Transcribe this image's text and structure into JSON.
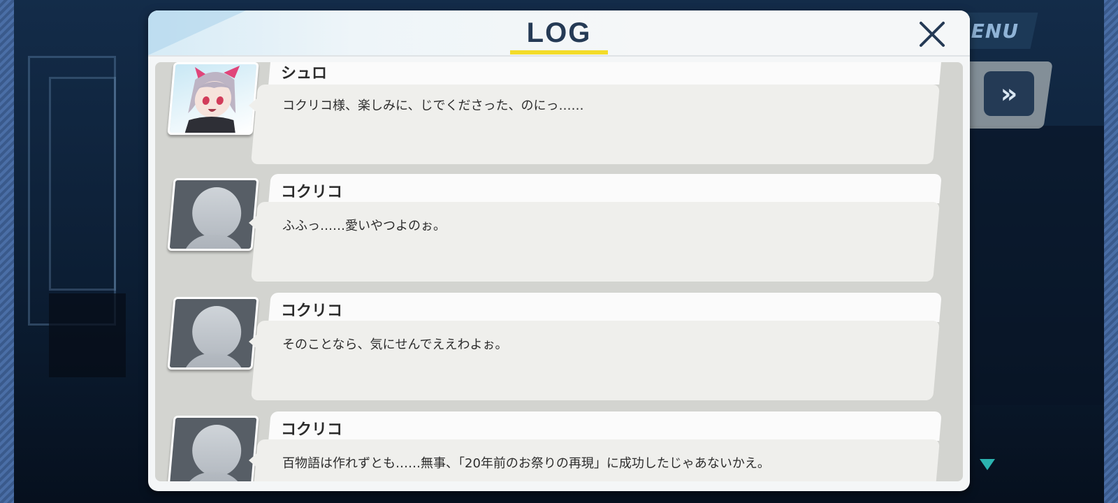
{
  "hud": {
    "menu_label": "MENU",
    "fast_forward_glyph": "»"
  },
  "dialog": {
    "title": "LOG",
    "entries": [
      {
        "speaker": "シュロ",
        "text": "コクリコ様、楽しみに、じでくださった、のにっ……",
        "avatar": "character-portrait"
      },
      {
        "speaker": "コクリコ",
        "text": "ふふっ……愛いやつよのぉ。",
        "avatar": "default-silhouette"
      },
      {
        "speaker": "コクリコ",
        "text": "そのことなら、気にせんでええわよぉ。",
        "avatar": "default-silhouette"
      },
      {
        "speaker": "コクリコ",
        "text": "百物語は作れずとも……無事、「20年前のお祭りの再現」に成功したじゃあないかえ。",
        "avatar": "default-silhouette"
      }
    ]
  },
  "colors": {
    "title": "#253a55",
    "underline": "#f3dc2a",
    "scroll_arrow": "#2bb3b0"
  }
}
